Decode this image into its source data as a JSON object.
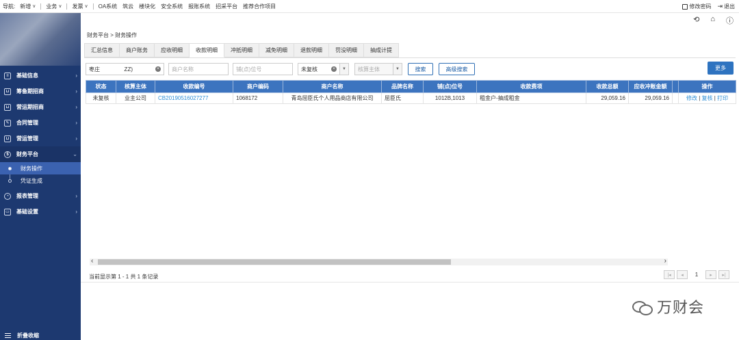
{
  "topbar": {
    "nav_label": "导航:",
    "items": [
      {
        "label": "新增",
        "dropdown": true
      },
      {
        "label": "业务",
        "dropdown": true
      },
      {
        "label": "发票",
        "dropdown": true
      },
      {
        "label": "OA系统",
        "dropdown": false
      },
      {
        "label": "筑云",
        "dropdown": false
      },
      {
        "label": "楼块化",
        "dropdown": false
      },
      {
        "label": "安全系统",
        "dropdown": false
      },
      {
        "label": "报账系统",
        "dropdown": false
      },
      {
        "label": "招采平台",
        "dropdown": false
      },
      {
        "label": "推荐合作项目",
        "dropdown": false
      }
    ],
    "change_password": "修改密码",
    "logout": "退出"
  },
  "sidebar": {
    "menu": [
      {
        "label": "基础信息"
      },
      {
        "label": "筹备期招商"
      },
      {
        "label": "营运期招商"
      },
      {
        "label": "合同管理"
      },
      {
        "label": "营运管理"
      },
      {
        "label": "财务平台"
      }
    ],
    "submenu": [
      {
        "label": "财务操作",
        "active": true
      },
      {
        "label": "凭证生成",
        "active": false
      }
    ],
    "menu_after": [
      {
        "label": "报表管理"
      },
      {
        "label": "基础设置"
      }
    ],
    "footer": "折叠收缩"
  },
  "breadcrumb": "财务平台 > 财务操作",
  "tabs": [
    "汇总信息",
    "商户账务",
    "应收明细",
    "收款明细",
    "冲抵明细",
    "减免明细",
    "退款明细",
    "罚没明细",
    "抽成计提"
  ],
  "active_tab": "收款明细",
  "filters": {
    "company_value": "枣庄                ZZ)",
    "merchant_placeholder": "商户名称",
    "berth_placeholder": "铺(点)位号",
    "status_value": "未复核",
    "accounting_placeholder": "核算主体",
    "search_button": "搜索",
    "advanced_button": "高级搜索",
    "more_button": "更多"
  },
  "table": {
    "columns": [
      "状态",
      "核算主体",
      "收款编号",
      "商户编码",
      "商户名称",
      "品牌名称",
      "铺(点)位号",
      "收款费项",
      "收款总额",
      "应收冲账金额",
      "",
      "操作"
    ],
    "rows": [
      {
        "status": "未复核",
        "accounting_entity": "业主公司",
        "receipt_no": "CB20190516027277",
        "merchant_code": "1068172",
        "merchant_name": "青岛屈臣氏个人用品商店有限公司",
        "brand": "屈臣氏",
        "berth": "1012B,1013",
        "fee_item": "租金户-抽成租金",
        "total": "29,059.16",
        "offset_amount": "29,059.16",
        "ops": [
          "修改",
          "复核",
          "打印"
        ]
      }
    ]
  },
  "pagination": {
    "records_text": "当前显示第 1 - 1 共 1 条记录",
    "current_page": "1"
  },
  "watermark": "万财会"
}
